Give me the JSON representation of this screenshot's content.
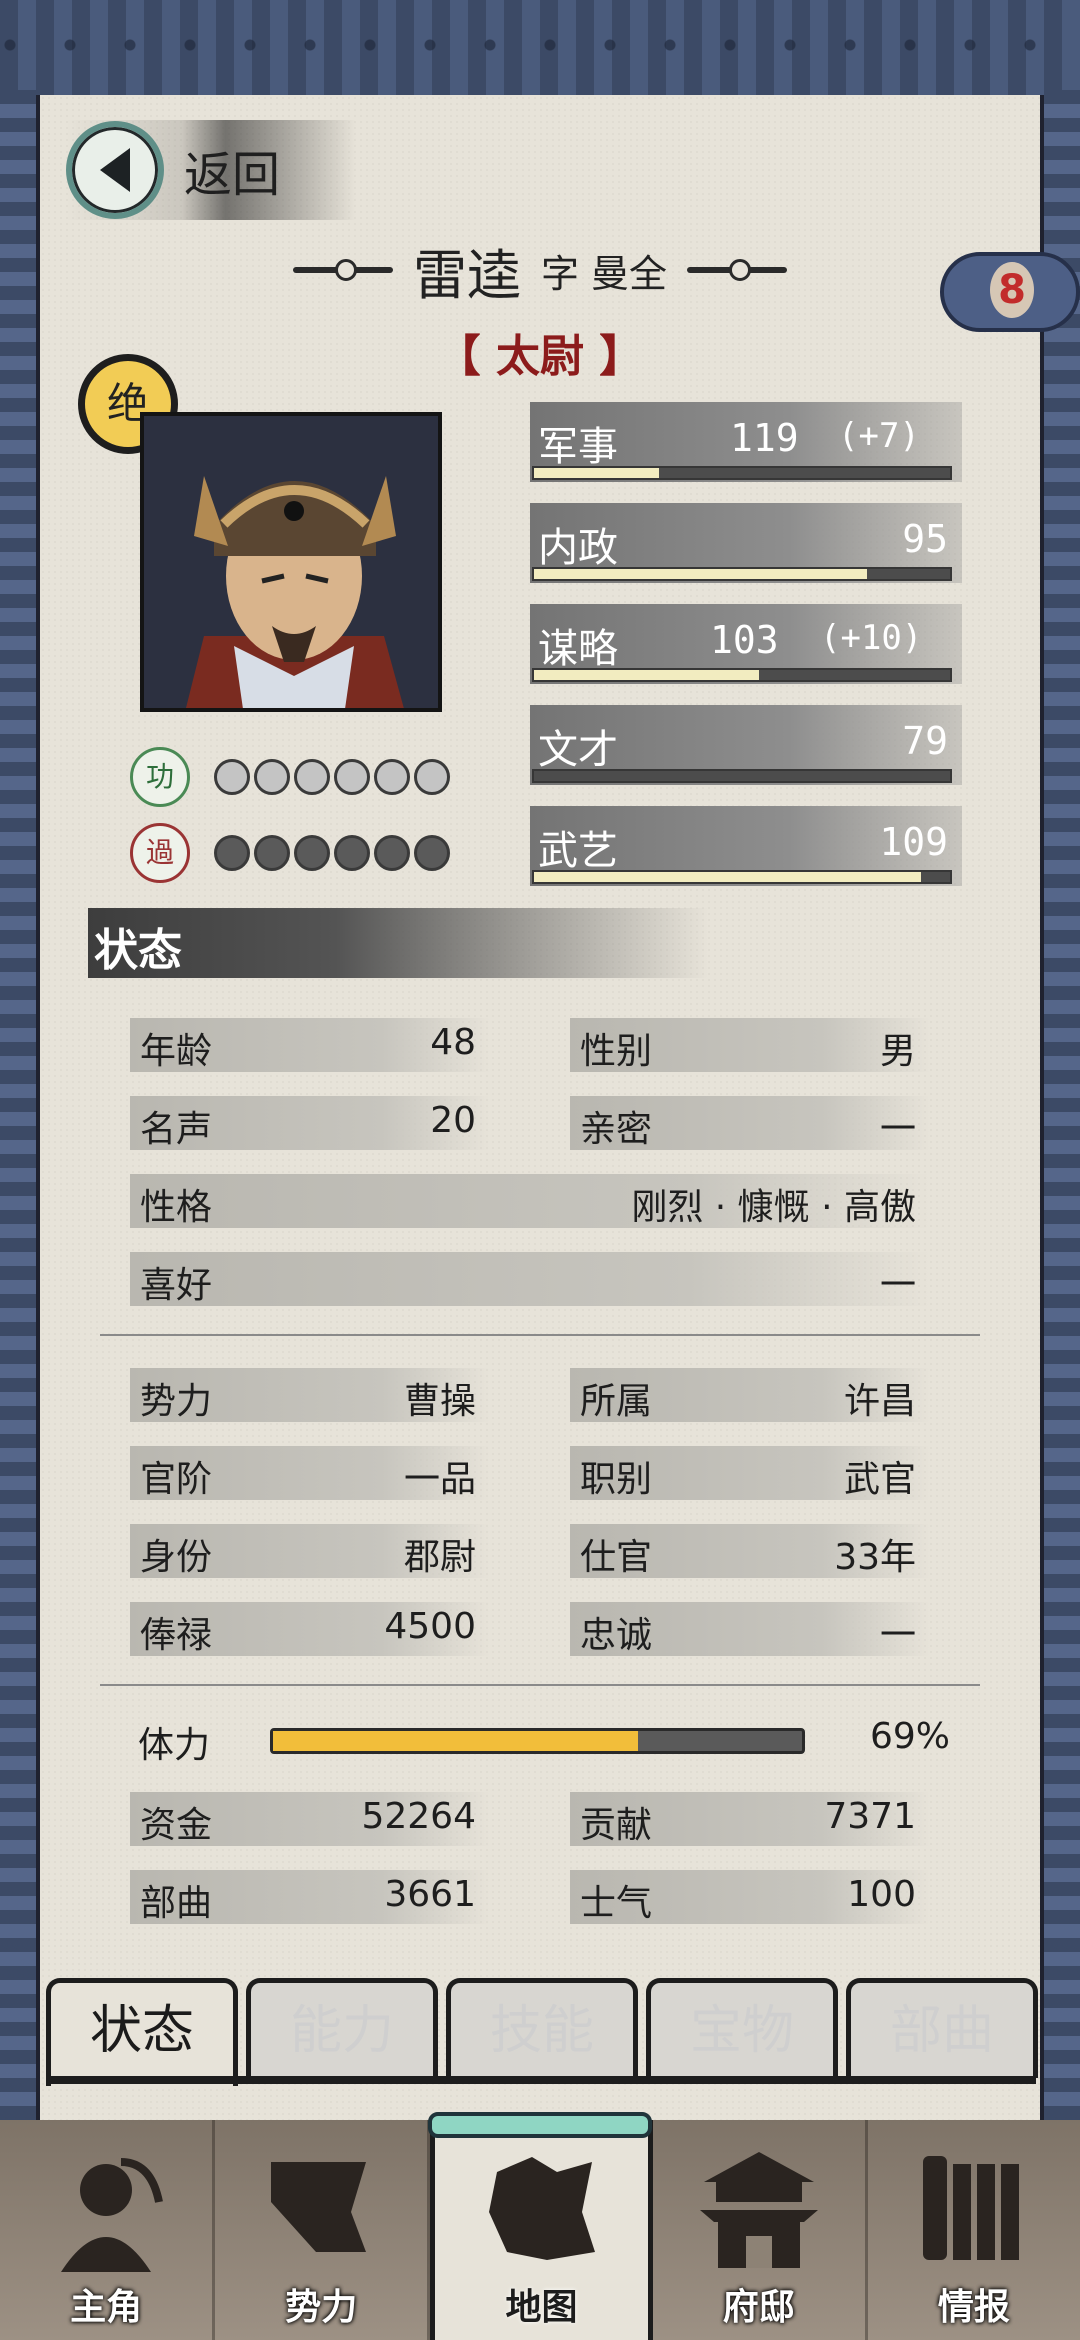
{
  "header": {
    "back_label": "返回",
    "name": "雷逵",
    "zi": "字 曼全",
    "title": "【 太尉 】",
    "cloud_badge": "8",
    "rank_badge": "绝"
  },
  "merit": {
    "gong_label": "功",
    "guo_label": "過",
    "gong_count": 6,
    "guo_count": 6
  },
  "stats": [
    {
      "label": "军事",
      "value": "119",
      "bonus": "(+7)",
      "fill": 0.3
    },
    {
      "label": "内政",
      "value": "95",
      "bonus": "",
      "fill": 0.8
    },
    {
      "label": "谋略",
      "value": "103",
      "bonus": "(+10)",
      "fill": 0.54
    },
    {
      "label": "文才",
      "value": "79",
      "bonus": "",
      "fill": 0.0
    },
    {
      "label": "武艺",
      "value": "109",
      "bonus": "",
      "fill": 0.93
    }
  ],
  "status": {
    "section_label": "状态",
    "age": {
      "label": "年龄",
      "value": "48"
    },
    "gender": {
      "label": "性别",
      "value": "男"
    },
    "fame": {
      "label": "名声",
      "value": "20"
    },
    "intimacy": {
      "label": "亲密",
      "value": "一"
    },
    "personality": {
      "label": "性格",
      "value": "刚烈 · 慷慨 · 高傲"
    },
    "hobby": {
      "label": "喜好",
      "value": "一"
    },
    "faction": {
      "label": "势力",
      "value": "曹操"
    },
    "belong": {
      "label": "所属",
      "value": "许昌"
    },
    "rank": {
      "label": "官阶",
      "value": "一品"
    },
    "job": {
      "label": "职别",
      "value": "武官"
    },
    "identity": {
      "label": "身份",
      "value": "郡尉"
    },
    "service": {
      "label": "仕官",
      "value": "33年"
    },
    "salary": {
      "label": "俸禄",
      "value": "4500"
    },
    "loyalty": {
      "label": "忠诚",
      "value": "一"
    },
    "stamina": {
      "label": "体力",
      "value": "69%",
      "fill": 0.69
    },
    "funds": {
      "label": "资金",
      "value": "52264"
    },
    "contribution": {
      "label": "贡献",
      "value": "7371"
    },
    "troops": {
      "label": "部曲",
      "value": "3661"
    },
    "morale": {
      "label": "士气",
      "value": "100"
    }
  },
  "tabs": [
    "状态",
    "能力",
    "技能",
    "宝物",
    "部曲"
  ],
  "nav": [
    "主角",
    "势力",
    "地图",
    "府邸",
    "情报"
  ]
}
